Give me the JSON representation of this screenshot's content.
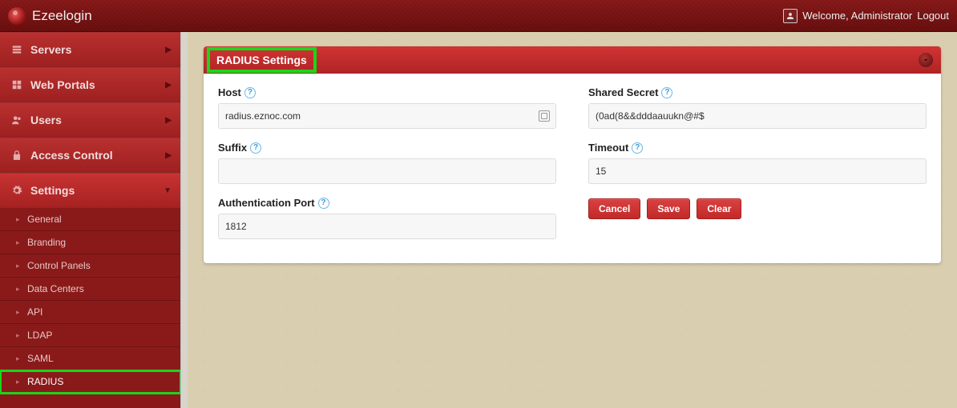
{
  "brand": "Ezeelogin",
  "header": {
    "welcome": "Welcome, Administrator",
    "logout": "Logout"
  },
  "sidebar": {
    "items": [
      {
        "label": "Servers",
        "icon": "servers"
      },
      {
        "label": "Web Portals",
        "icon": "grid"
      },
      {
        "label": "Users",
        "icon": "users"
      },
      {
        "label": "Access Control",
        "icon": "lock"
      },
      {
        "label": "Settings",
        "icon": "gears",
        "active": true
      }
    ],
    "settings_sub": [
      {
        "label": "General"
      },
      {
        "label": "Branding"
      },
      {
        "label": "Control Panels"
      },
      {
        "label": "Data Centers"
      },
      {
        "label": "API"
      },
      {
        "label": "LDAP"
      },
      {
        "label": "SAML"
      },
      {
        "label": "RADIUS",
        "selected": true
      }
    ]
  },
  "panel": {
    "title": "RADIUS Settings",
    "fields": {
      "host_label": "Host",
      "host_value": "radius.eznoc.com",
      "suffix_label": "Suffix",
      "suffix_value": "",
      "auth_port_label": "Authentication Port",
      "auth_port_value": "1812",
      "secret_label": "Shared Secret",
      "secret_value": "(0ad(8&&dddaauukn@#$",
      "timeout_label": "Timeout",
      "timeout_value": "15"
    },
    "buttons": {
      "cancel": "Cancel",
      "save": "Save",
      "clear": "Clear"
    }
  }
}
